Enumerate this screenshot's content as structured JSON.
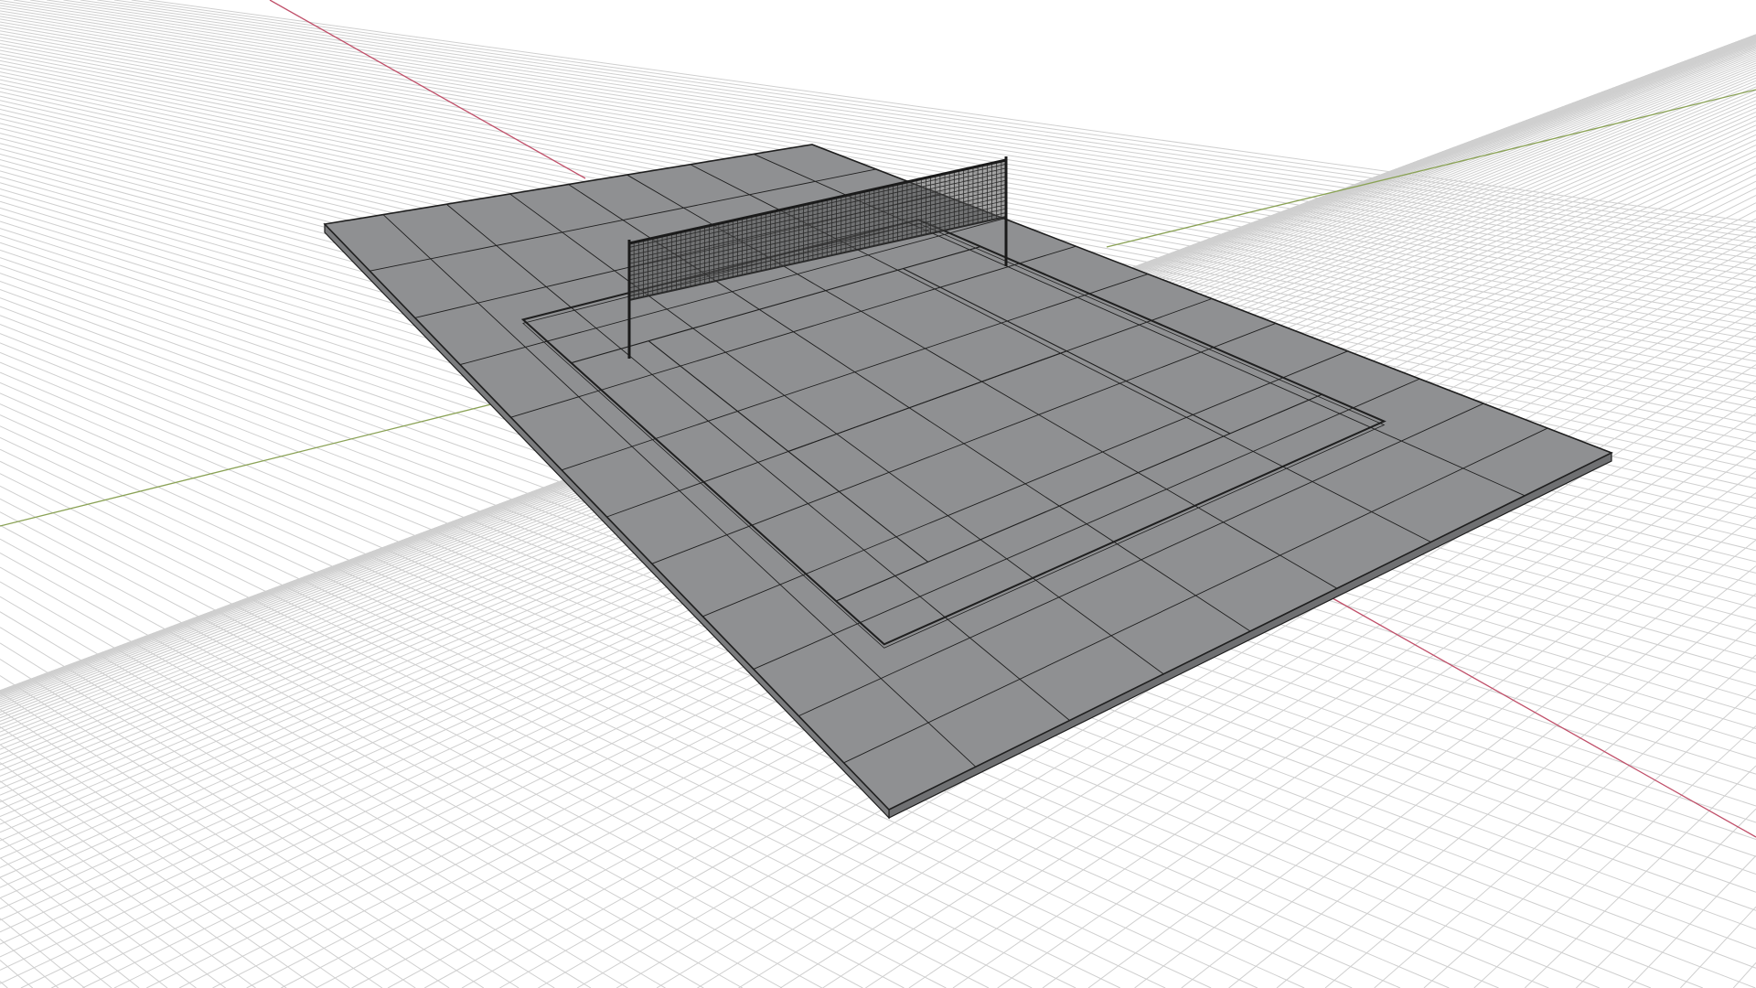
{
  "viewport": {
    "mode": "perspective",
    "display_mode": "shaded",
    "background_color": "#ffffff",
    "grid_visible": true,
    "grid_color": "#cfcfcf",
    "x_axis_color": "#c0506a",
    "y_axis_color": "#8aa255"
  },
  "model": {
    "object_name": "tennis-court",
    "surface_color": "#8f9092",
    "wire_color": "#1f1f1f",
    "net_color": "#2a2a2a"
  }
}
